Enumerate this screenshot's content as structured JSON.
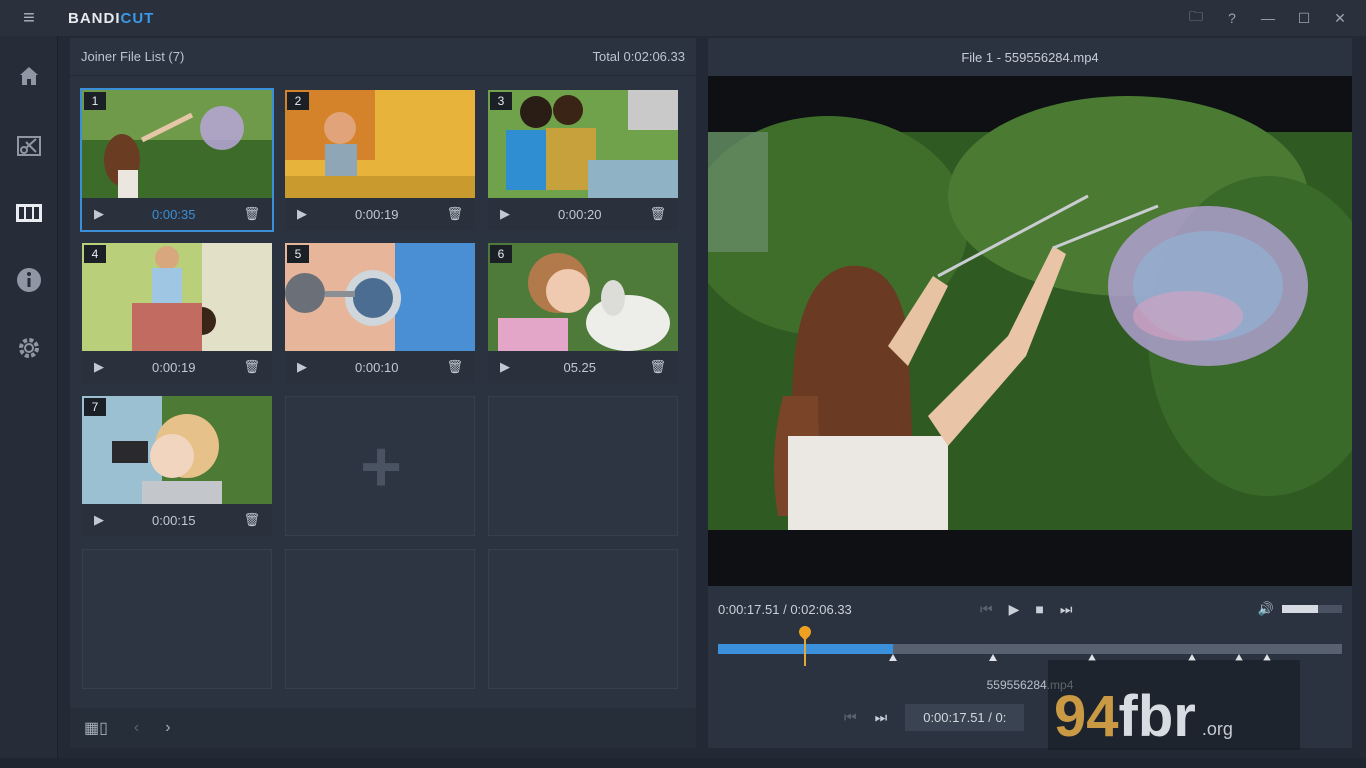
{
  "app": {
    "logo_main": "BANDI",
    "logo_accent": "CUT",
    "menu_icon": "≡"
  },
  "window_controls": [
    "🗀",
    "?",
    "—",
    "☐",
    "✕"
  ],
  "sidebar": {
    "items": [
      "home-icon",
      "cut-icon",
      "joiner-icon",
      "info-icon",
      "settings-icon"
    ]
  },
  "file_list": {
    "title": "Joiner File List (7)",
    "total": "Total 0:02:06.33",
    "items": [
      {
        "num": "1",
        "duration": "0:00:35"
      },
      {
        "num": "2",
        "duration": "0:00:19"
      },
      {
        "num": "3",
        "duration": "0:00:20"
      },
      {
        "num": "4",
        "duration": "0:00:19"
      },
      {
        "num": "5",
        "duration": "0:00:10"
      },
      {
        "num": "6",
        "duration": "05.25"
      },
      {
        "num": "7",
        "duration": "0:00:15"
      }
    ],
    "add_symbol": "+",
    "footer": {
      "grid_icon": "▦▯",
      "prev": "‹",
      "next": "›"
    }
  },
  "preview": {
    "title": "File 1 - 559556284.mp4",
    "current_time": "0:00:17.51",
    "separator": "/",
    "total_time": "0:02:06.33",
    "volume_level": 0.6,
    "playhead_fraction": 0.138,
    "played_fraction": 0.28,
    "markers": [
      0.28,
      0.44,
      0.6,
      0.76,
      0.835,
      0.88
    ],
    "filename_label": "559556284.mp4",
    "bottom_time": "0:00:17.51 / 0:"
  },
  "watermark": {
    "num": "94",
    "text": "fbr",
    "org": ".org"
  },
  "colors": {
    "accent": "#3a8fd6",
    "playhead": "#f0a020"
  }
}
